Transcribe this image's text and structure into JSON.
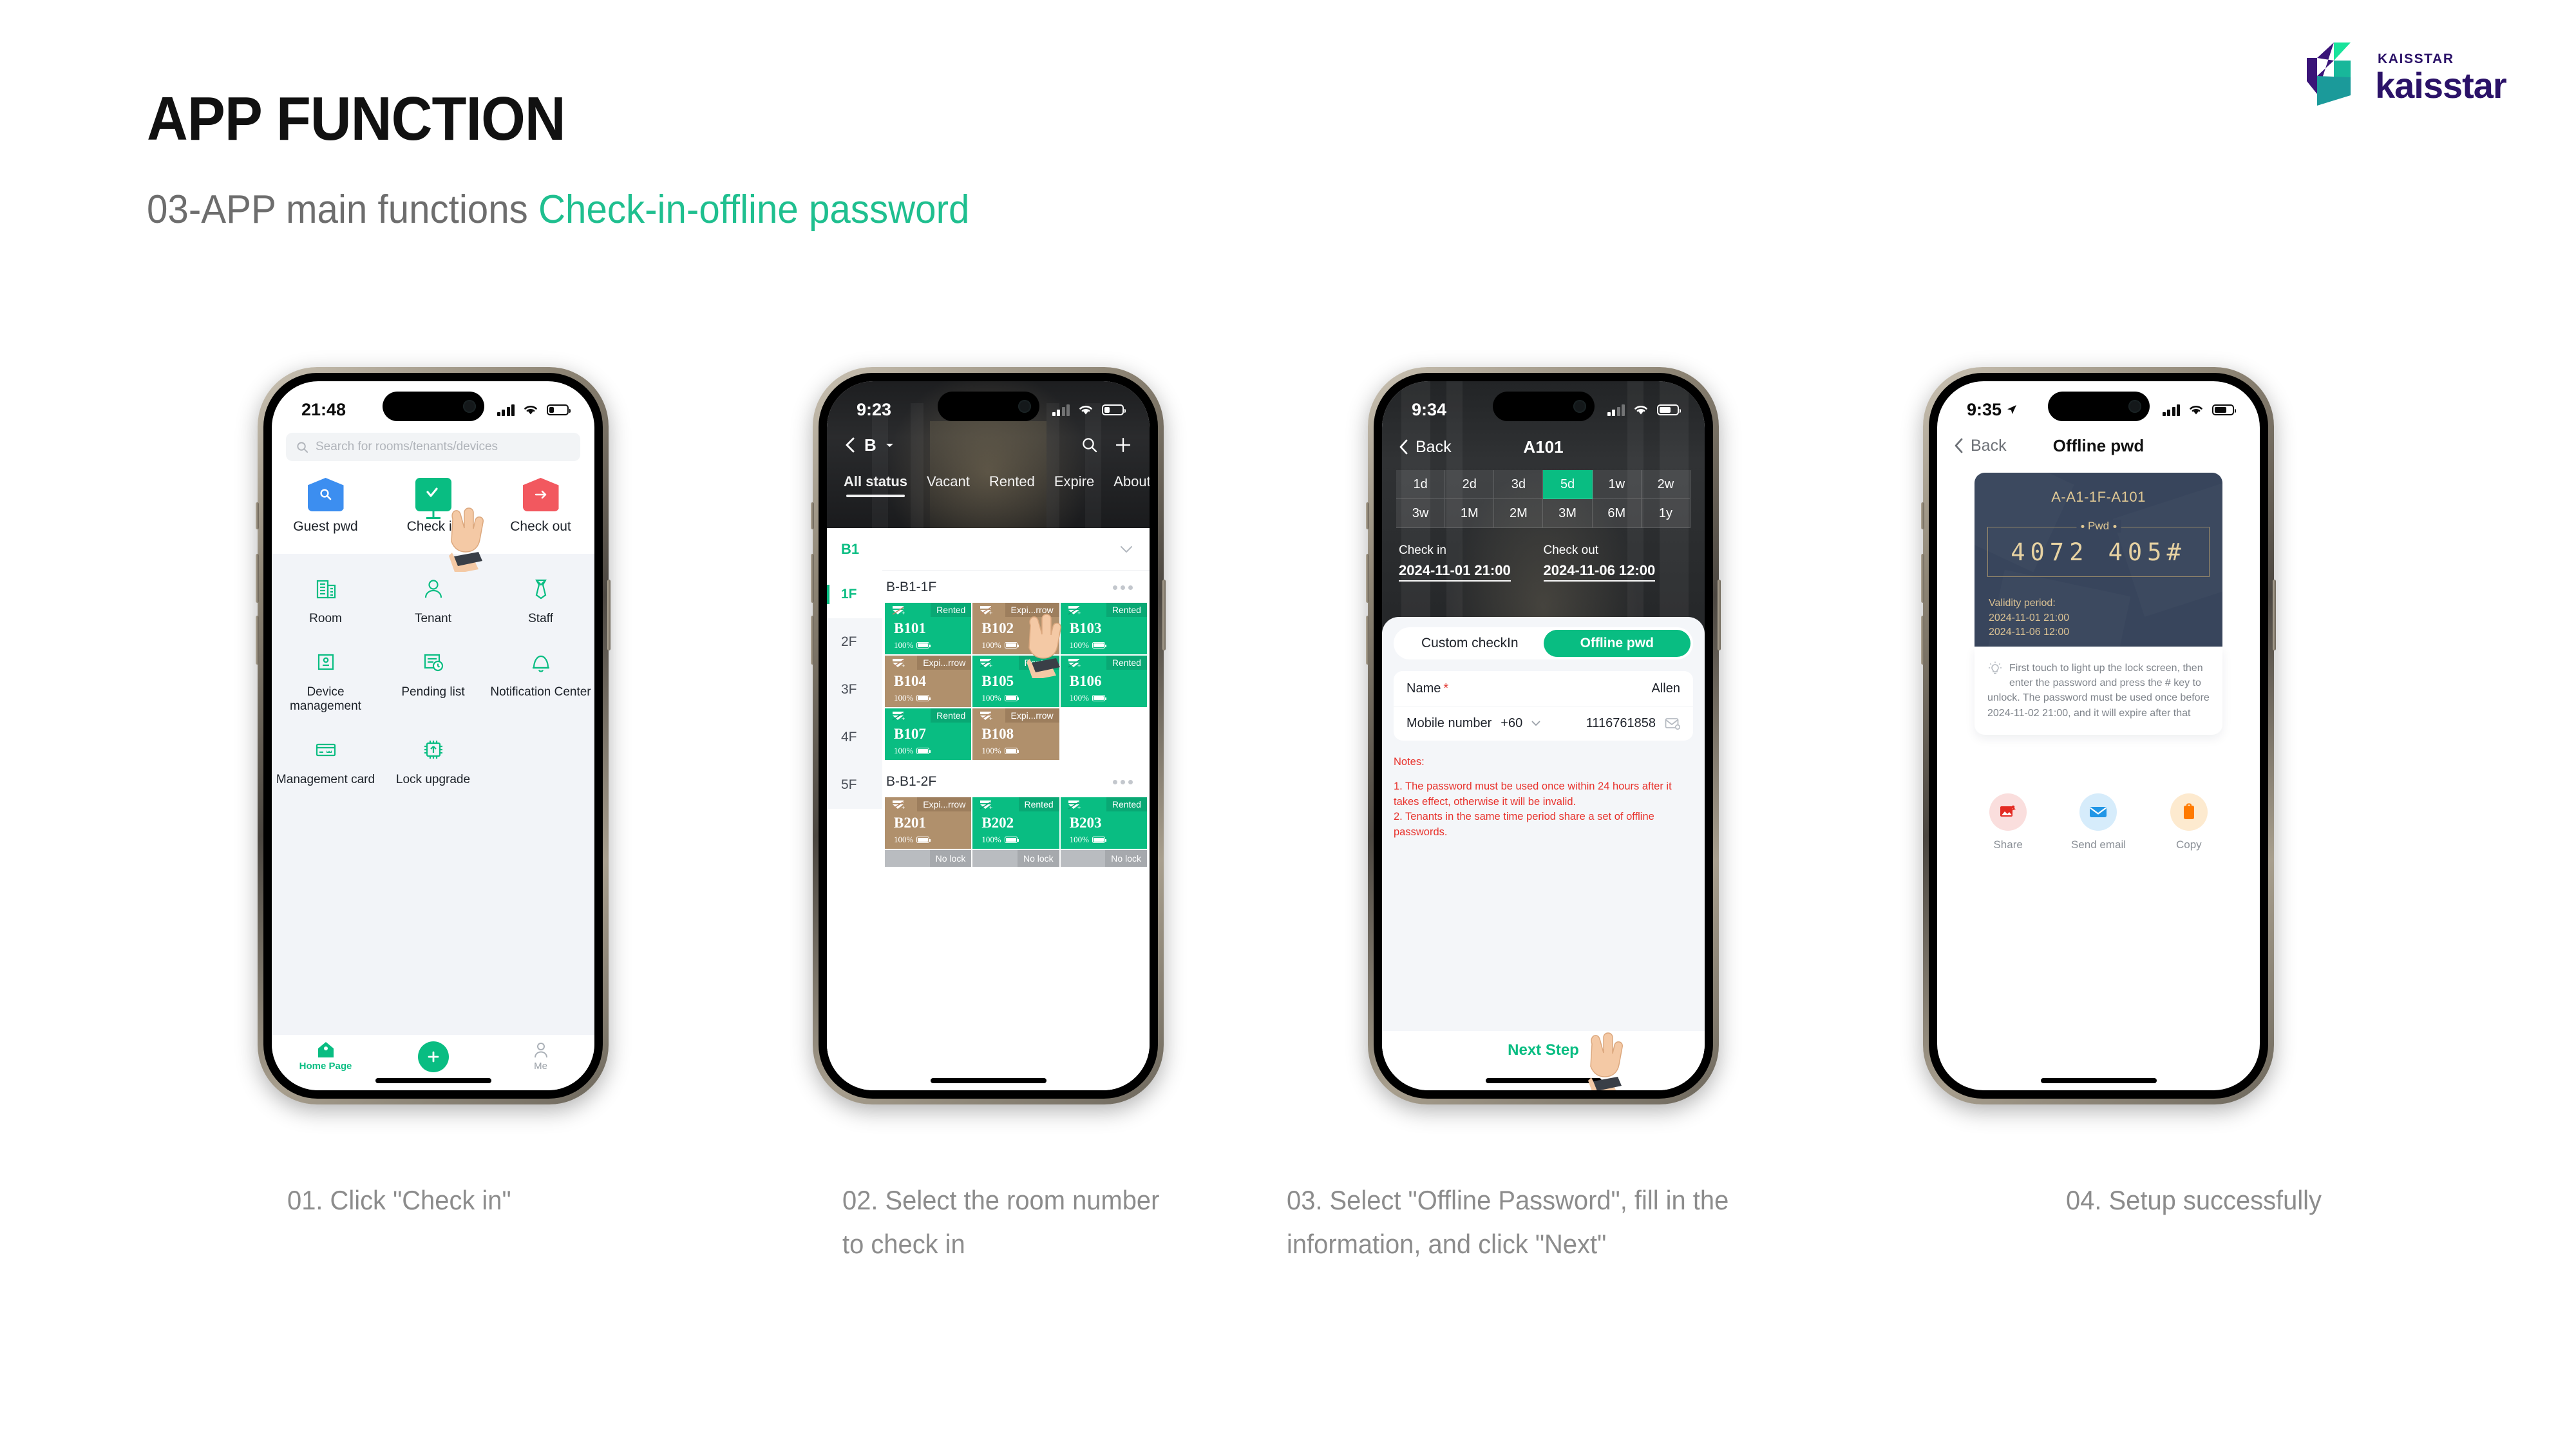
{
  "slide": {
    "title": "APP FUNCTION",
    "subtitle_plain": "03-APP main functions ",
    "subtitle_accent": "Check-in-offline password",
    "accent_color": "#1fbf8f"
  },
  "logo": {
    "small_text": "KAISSTAR",
    "big_text": "kaisstar",
    "purple": "#2b1268",
    "teal": "#1fbf8f"
  },
  "phone1": {
    "status": {
      "time": "21:48"
    },
    "search": {
      "placeholder": "Search for rooms/tenants/devices",
      "icon": "search-icon"
    },
    "quick_actions": [
      {
        "label": "Guest pwd",
        "icon": "home-search-icon",
        "color": "#3c8ef0"
      },
      {
        "label": "Check in",
        "icon": "check-monitor-icon",
        "color": "#09bd82"
      },
      {
        "label": "Check out",
        "icon": "home-arrow-icon",
        "color": "#f2585f"
      }
    ],
    "grid": [
      [
        {
          "label": "Room",
          "icon": "building-icon"
        },
        {
          "label": "Tenant",
          "icon": "user-icon"
        },
        {
          "label": "Staff",
          "icon": "tie-icon"
        }
      ],
      [
        {
          "label": "Device management",
          "icon": "device-card-icon"
        },
        {
          "label": "Pending list",
          "icon": "pending-clock-icon"
        },
        {
          "label": "Notification Center",
          "icon": "bell-icon"
        }
      ],
      [
        {
          "label": "Management card",
          "icon": "management-card-icon"
        },
        {
          "label": "Lock upgrade",
          "icon": "chip-upload-icon"
        }
      ]
    ],
    "tabbar": [
      {
        "label": "Home Page",
        "icon": "home-icon",
        "active": true
      },
      {
        "label": "",
        "icon": "plus-fab-icon",
        "active": false
      },
      {
        "label": "Me",
        "icon": "person-icon",
        "active": false
      }
    ]
  },
  "phone2": {
    "status": {
      "time": "9:23"
    },
    "nav": {
      "building": "B",
      "back_icon": "chevron-left-icon",
      "search_icon": "search-icon",
      "add_icon": "plus-icon"
    },
    "tabs": [
      "All status",
      "Vacant",
      "Rented",
      "Expire",
      "About t"
    ],
    "active_tab": "All status",
    "unit_label": "B1",
    "floors": [
      "1F",
      "2F",
      "3F",
      "4F",
      "5F"
    ],
    "active_floor": "1F",
    "groups": [
      {
        "name": "B-B1-1F",
        "rooms": [
          {
            "name": "B101",
            "status": "Rented",
            "battery": "100%",
            "state": "rented"
          },
          {
            "name": "B102",
            "status": "Expi...rrow",
            "battery": "100%",
            "state": "expiring"
          },
          {
            "name": "B103",
            "status": "Rented",
            "battery": "100%",
            "state": "rented"
          },
          {
            "name": "B104",
            "status": "Expi...rrow",
            "battery": "100%",
            "state": "expiring"
          },
          {
            "name": "B105",
            "status": "Rented",
            "battery": "100%",
            "state": "rented"
          },
          {
            "name": "B106",
            "status": "Rented",
            "battery": "100%",
            "state": "rented"
          },
          {
            "name": "B107",
            "status": "Rented",
            "battery": "100%",
            "state": "rented"
          },
          {
            "name": "B108",
            "status": "Expi...rrow",
            "battery": "100%",
            "state": "expiring"
          }
        ]
      },
      {
        "name": "B-B1-2F",
        "rooms": [
          {
            "name": "B201",
            "status": "Expi...rrow",
            "battery": "100%",
            "state": "expiring"
          },
          {
            "name": "B202",
            "status": "Rented",
            "battery": "100%",
            "state": "rented"
          },
          {
            "name": "B203",
            "status": "Rented",
            "battery": "100%",
            "state": "rented"
          }
        ],
        "nolock": [
          "No lock",
          "No lock",
          "No lock"
        ]
      }
    ]
  },
  "phone3": {
    "status": {
      "time": "9:34"
    },
    "nav": {
      "back": "Back",
      "title": "A101"
    },
    "durations": [
      "1d",
      "2d",
      "3d",
      "5d",
      "1w",
      "2w",
      "3w",
      "1M",
      "2M",
      "3M",
      "6M",
      "1y"
    ],
    "selected_duration": "5d",
    "checkin": {
      "label": "Check in",
      "value": "2024-11-01 21:00"
    },
    "checkout": {
      "label": "Check out",
      "value": "2024-11-06 12:00"
    },
    "segments": [
      "Custom checkIn",
      "Offline pwd"
    ],
    "selected_segment": "Offline pwd",
    "form": {
      "name_label": "Name",
      "name_required": "*",
      "name_value": "Allen",
      "mobile_label": "Mobile number",
      "country_code": "+60",
      "mobile_value": "1116761858",
      "mobile_icon": "contact-card-icon"
    },
    "notes": {
      "title": "Notes:",
      "items": [
        "1. The password must be used once within 24 hours after it takes effect, otherwise it will be invalid.",
        "2. Tenants in the same time period share a set of offline passwords."
      ],
      "color": "#e8322c"
    },
    "next_button": "Next Step"
  },
  "phone4": {
    "status": {
      "time": "9:35",
      "location_icon": "location-arrow-icon"
    },
    "nav": {
      "back": "Back",
      "title": "Offline pwd"
    },
    "card": {
      "room_path": "A-A1-1F-A101",
      "pwd_caption": "Pwd",
      "password": "4072 405#",
      "validity_label": "Validity period:",
      "validity_start": "2024-11-01 21:00",
      "validity_end": "2024-11-06 12:00",
      "bg_color": "#38455c",
      "gold_color": "#e0c894"
    },
    "hint": {
      "icon": "lightbulb-icon",
      "text": "First touch to light up the lock screen, then enter the password and press the # key to unlock. The password must be used once before 2024-11-02 21:00, and it will expire after that"
    },
    "actions": [
      {
        "label": "Share",
        "icon": "share-image-icon",
        "color": "#e32a22",
        "bg": "#fadedd"
      },
      {
        "label": "Send email",
        "icon": "envelope-icon",
        "color": "#2196e6",
        "bg": "#d6ecfb"
      },
      {
        "label": "Copy",
        "icon": "clipboard-icon",
        "color": "#ff7a00",
        "bg": "#fdeacf"
      }
    ]
  },
  "captions": {
    "c1": "01. Click \"Check in\"",
    "c2": "02. Select the room number to check in",
    "c3": "03. Select \"Offline Password\", fill in the information, and click \"Next\"",
    "c4": "04. Setup successfully"
  }
}
